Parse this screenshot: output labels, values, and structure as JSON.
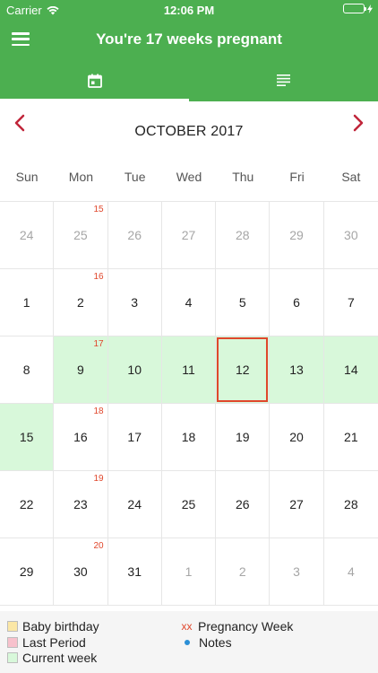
{
  "status_bar": {
    "carrier": "Carrier",
    "time": "12:06 PM",
    "battery_level": 1.0
  },
  "nav": {
    "title": "You're 17 weeks pregnant"
  },
  "tabs": [
    {
      "icon": "calendar-icon",
      "active": true
    },
    {
      "icon": "list-icon",
      "active": false
    }
  ],
  "calendar": {
    "month_label": "OCTOBER 2017",
    "weekdays": [
      "Sun",
      "Mon",
      "Tue",
      "Wed",
      "Thu",
      "Fri",
      "Sat"
    ],
    "weeks": [
      {
        "week_label": "15",
        "days": [
          {
            "d": "24",
            "muted": true
          },
          {
            "d": "25",
            "muted": true
          },
          {
            "d": "26",
            "muted": true
          },
          {
            "d": "27",
            "muted": true
          },
          {
            "d": "28",
            "muted": true
          },
          {
            "d": "29",
            "muted": true
          },
          {
            "d": "30",
            "muted": true
          }
        ]
      },
      {
        "week_label": "16",
        "days": [
          {
            "d": "1"
          },
          {
            "d": "2"
          },
          {
            "d": "3"
          },
          {
            "d": "4"
          },
          {
            "d": "5"
          },
          {
            "d": "6"
          },
          {
            "d": "7"
          }
        ]
      },
      {
        "week_label": "17",
        "days": [
          {
            "d": "8"
          },
          {
            "d": "9",
            "current": true
          },
          {
            "d": "10",
            "current": true
          },
          {
            "d": "11",
            "current": true
          },
          {
            "d": "12",
            "current": true,
            "today": true
          },
          {
            "d": "13",
            "current": true
          },
          {
            "d": "14",
            "current": true
          }
        ]
      },
      {
        "week_label": "18",
        "days": [
          {
            "d": "15",
            "current": true
          },
          {
            "d": "16"
          },
          {
            "d": "17"
          },
          {
            "d": "18"
          },
          {
            "d": "19"
          },
          {
            "d": "20"
          },
          {
            "d": "21"
          }
        ]
      },
      {
        "week_label": "19",
        "days": [
          {
            "d": "22"
          },
          {
            "d": "23"
          },
          {
            "d": "24"
          },
          {
            "d": "25"
          },
          {
            "d": "26"
          },
          {
            "d": "27"
          },
          {
            "d": "28"
          }
        ]
      },
      {
        "week_label": "20",
        "days": [
          {
            "d": "29"
          },
          {
            "d": "30"
          },
          {
            "d": "31"
          },
          {
            "d": "1",
            "muted": true
          },
          {
            "d": "2",
            "muted": true
          },
          {
            "d": "3",
            "muted": true
          },
          {
            "d": "4",
            "muted": true
          }
        ]
      }
    ]
  },
  "legend": {
    "baby_birthday": {
      "label": "Baby birthday",
      "color": "#fbe7a6"
    },
    "last_period": {
      "label": "Last Period",
      "color": "#f7c1cc"
    },
    "current_week": {
      "label": "Current week",
      "color": "#d8f8da"
    },
    "pregnancy_week": {
      "marker": "xx",
      "label": "Pregnancy Week"
    },
    "notes": {
      "label": "Notes",
      "color": "#2b8fd6"
    }
  },
  "colors": {
    "header": "#4caf50",
    "accent": "#e0472c",
    "arrow": "#c0253a"
  }
}
